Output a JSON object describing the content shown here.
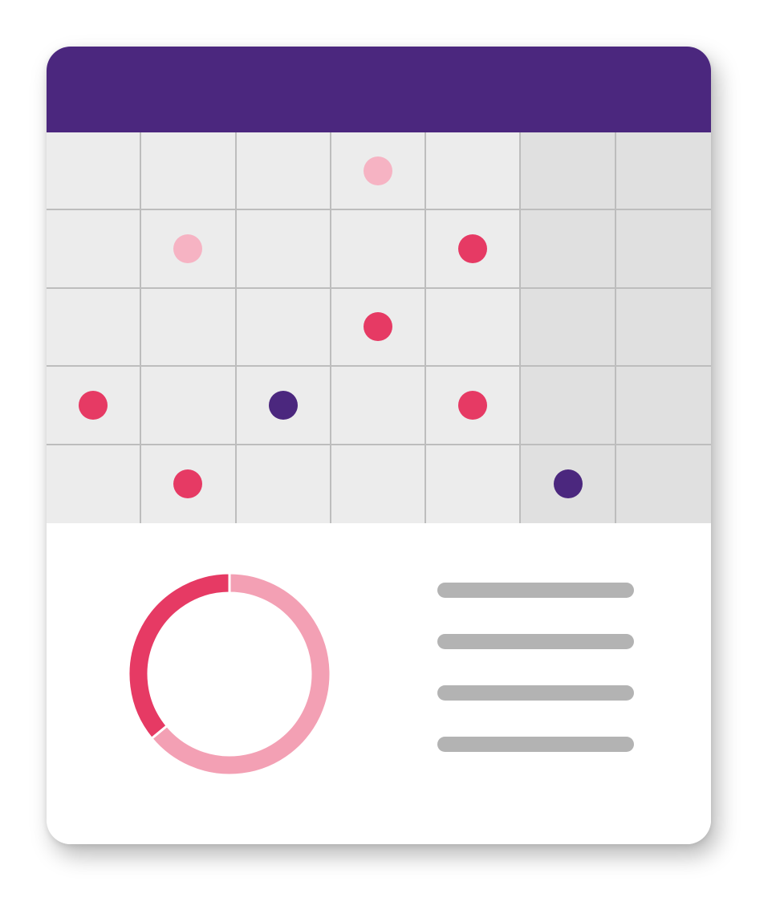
{
  "colors": {
    "header": "#4b277e",
    "weekday_cell": "#ececec",
    "weekend_cell": "#e0e0e0",
    "grid_line": "#bdbdbd",
    "legend_line": "#b3b3b3"
  },
  "calendar": {
    "columns": 7,
    "rows": 5,
    "weekend_columns": [
      5,
      6
    ],
    "events": [
      {
        "row": 0,
        "col": 3,
        "color": "#f6b3c3"
      },
      {
        "row": 1,
        "col": 1,
        "color": "#f6b3c3"
      },
      {
        "row": 1,
        "col": 4,
        "color": "#e63a64"
      },
      {
        "row": 2,
        "col": 3,
        "color": "#e63a64"
      },
      {
        "row": 3,
        "col": 0,
        "color": "#e63a64"
      },
      {
        "row": 3,
        "col": 2,
        "color": "#4b277e"
      },
      {
        "row": 3,
        "col": 4,
        "color": "#e63a64"
      },
      {
        "row": 4,
        "col": 1,
        "color": "#e63a64"
      },
      {
        "row": 4,
        "col": 5,
        "color": "#4b277e"
      }
    ]
  },
  "chart_data": {
    "type": "pie",
    "style": "donut",
    "slices": [
      {
        "value": 64,
        "color": "#f3a0b4"
      },
      {
        "value": 36,
        "color": "#e63a64"
      }
    ]
  },
  "legend": {
    "line_count": 4
  }
}
